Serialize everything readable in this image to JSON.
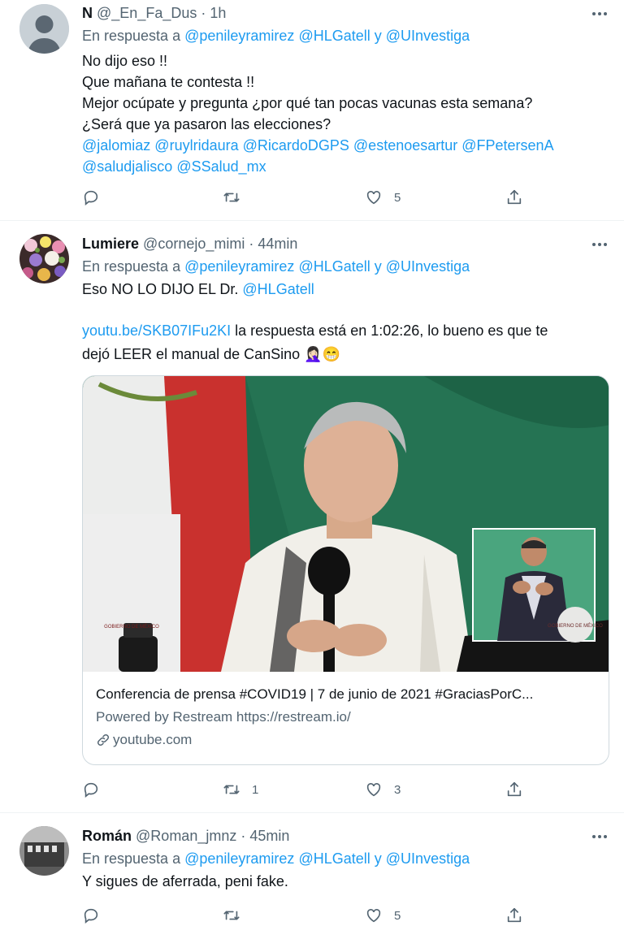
{
  "tweets": [
    {
      "name": "N",
      "handle": "@_En_Fa_Dus",
      "time": "· 1h",
      "reply_prefix": "En respuesta a",
      "reply_m1": "@penileyramirez",
      "reply_m2": "@HLGatell",
      "reply_and": "y",
      "reply_m3": "@UInvestiga",
      "lines": [
        "No dijo eso !!",
        "Que mañana te contesta !!",
        "Mejor ocúpate y pregunta ¿por qué tan pocas vacunas esta semana?",
        "¿Será que ya pasaron las elecciones?"
      ],
      "mentions1": "@jalomiaz  @ruylridaura @RicardoDGPS @estenoesartur @FPetersenA",
      "mentions2": "@saludjalisco @SSalud_mx",
      "reply_count": "",
      "retweet_count": "",
      "like_count": "5"
    },
    {
      "name": "Lumiere",
      "handle": "@cornejo_mimi",
      "time": "· 44min",
      "reply_prefix": "En respuesta a",
      "reply_m1": "@penileyramirez",
      "reply_m2": "@HLGatell",
      "reply_and": "y",
      "reply_m3": "@UInvestiga",
      "line1_text": "Eso NO LO DIJO EL Dr.",
      "line1_mention": "@HLGatell",
      "link": "youtu.be/SKB07IFu2KI",
      "line3_text": " la respuesta está en  1:02:26, lo bueno es que te",
      "line4_text": "dejó LEER el manual de CanSino 🤦🏻‍♀️😁",
      "card": {
        "title": "Conferencia de prensa #COVID19 | 7 de junio de 2021 #GraciasPorC...",
        "desc": "Powered by Restream https://restream.io/",
        "domain": "youtube.com",
        "flag_text": "GOBIERNO DE MÉXICO",
        "seal_text": "GOBIERNO DE MÉXICO"
      },
      "reply_count": "",
      "retweet_count": "1",
      "like_count": "3"
    },
    {
      "name": "Román",
      "handle": "@Roman_jmnz",
      "time": "· 45min",
      "reply_prefix": "En respuesta a",
      "reply_m1": "@penileyramirez",
      "reply_m2": "@HLGatell",
      "reply_and": "y",
      "reply_m3": "@UInvestiga",
      "text": "Y sigues de aferrada, peni fake.",
      "reply_count": "",
      "retweet_count": "",
      "like_count": "5"
    }
  ],
  "colors": {
    "link": "#1d9bf0",
    "muted": "#536471",
    "text": "#0f1419"
  },
  "icons": [
    "reply-icon",
    "retweet-icon",
    "like-icon",
    "share-icon",
    "more-icon",
    "link-icon"
  ]
}
